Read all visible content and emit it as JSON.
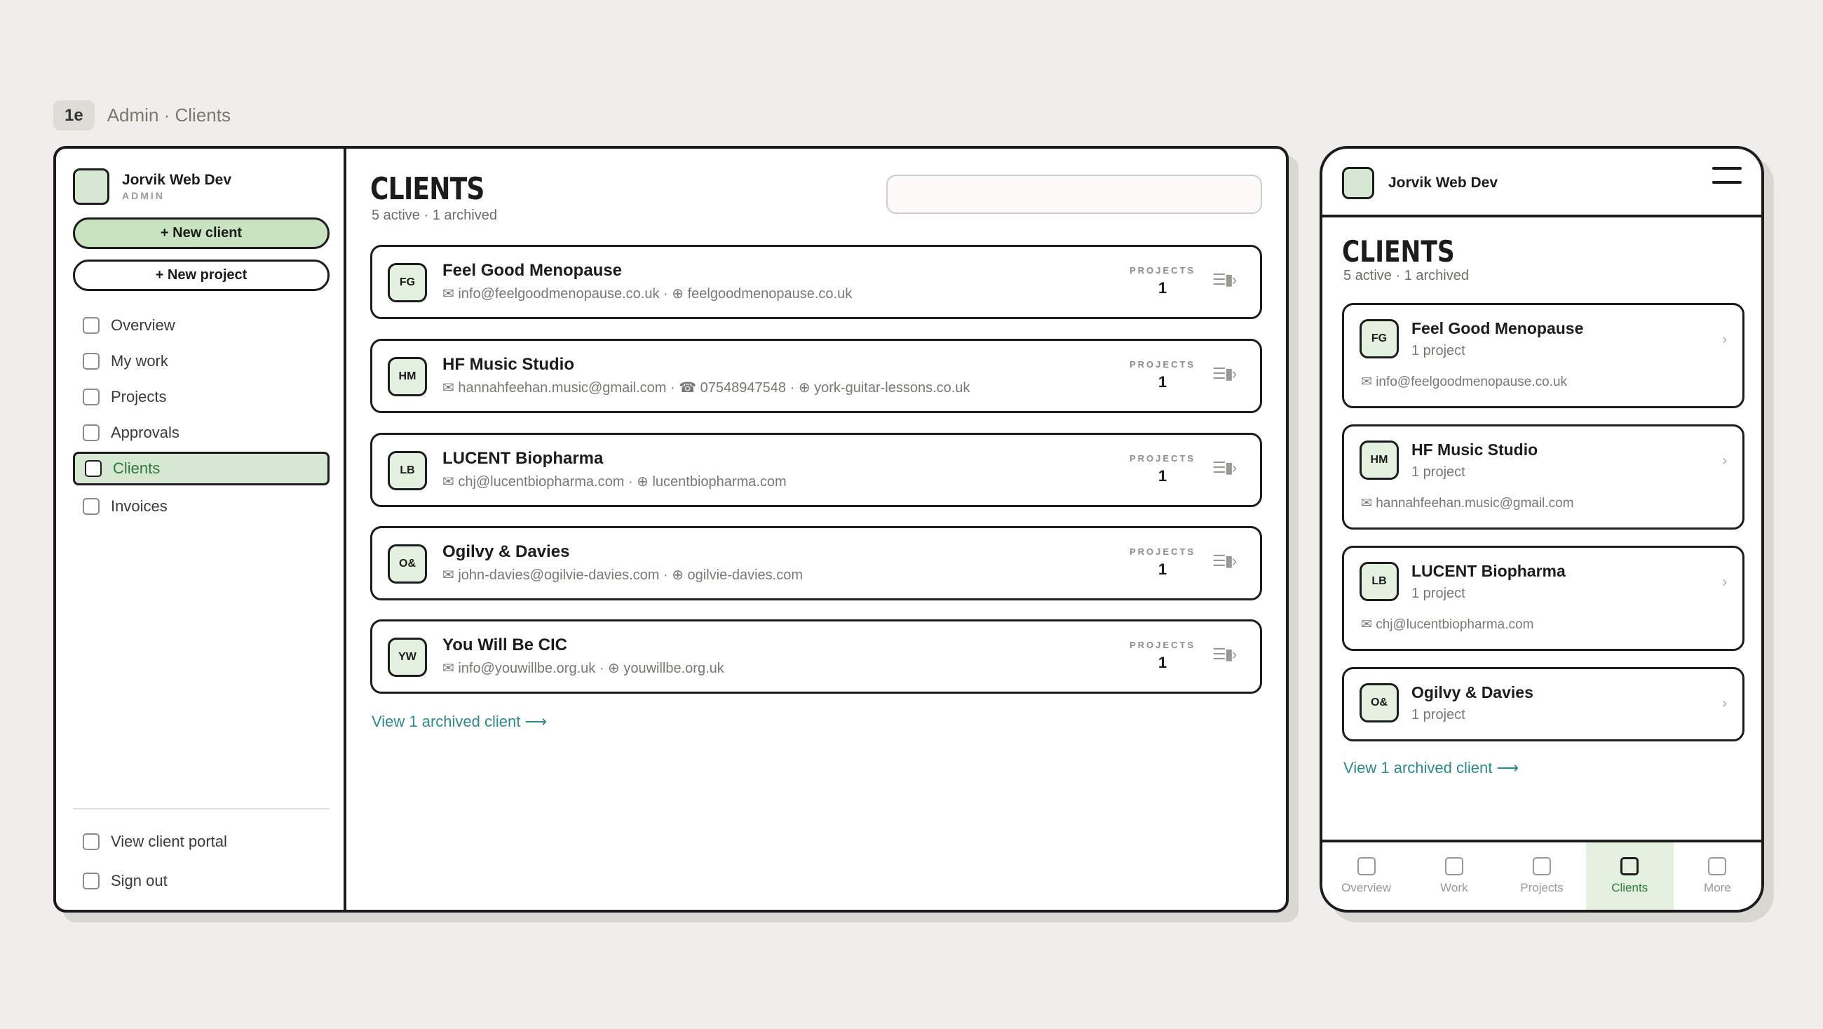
{
  "caption": {
    "tag": "1e",
    "crumb": "Admin · Clients"
  },
  "brand": {
    "name": "Jorvik Web Dev",
    "role": "ADMIN"
  },
  "sidebar": {
    "new_client": "+ New client",
    "new_project": "+ New project",
    "items": [
      {
        "label": "Overview"
      },
      {
        "label": "My work"
      },
      {
        "label": "Projects"
      },
      {
        "label": "Approvals"
      },
      {
        "label": "Clients"
      },
      {
        "label": "Invoices"
      }
    ],
    "footer": [
      {
        "label": "View client portal"
      },
      {
        "label": "Sign out"
      }
    ]
  },
  "main": {
    "title": "CLIENTS",
    "subtitle": "5 active · 1 archived",
    "search_placeholder": "",
    "projects_label": "PROJECTS",
    "clients": [
      {
        "initials": "FG",
        "name": "Feel Good Menopause",
        "info": "✉ info@feelgoodmenopause.co.uk · ⊕ feelgoodmenopause.co.uk",
        "projects": "1"
      },
      {
        "initials": "HM",
        "name": "HF Music Studio",
        "info": "✉ hannahfeehan.music@gmail.com · ☎ 07548947548 · ⊕ york-guitar-lessons.co.uk",
        "projects": "1"
      },
      {
        "initials": "LB",
        "name": "LUCENT Biopharma",
        "info": "✉ chj@lucentbiopharma.com · ⊕ lucentbiopharma.com",
        "projects": "1"
      },
      {
        "initials": "O&",
        "name": "Ogilvy & Davies",
        "info": "✉ john-davies@ogilvie-davies.com · ⊕ ogilvie-davies.com",
        "projects": "1"
      },
      {
        "initials": "YW",
        "name": "You Will Be CIC",
        "info": "✉ info@youwillbe.org.uk · ⊕ youwillbe.org.uk",
        "projects": "1"
      }
    ],
    "card_actions": "☰▮›",
    "archived_link": "View 1 archived client ⟶"
  },
  "mobile": {
    "title": "CLIENTS",
    "subtitle": "5 active · 1 archived",
    "clients": [
      {
        "initials": "FG",
        "name": "Feel Good Menopause",
        "projects": "1 project",
        "email": "✉ info@feelgoodmenopause.co.uk"
      },
      {
        "initials": "HM",
        "name": "HF Music Studio",
        "projects": "1 project",
        "email": "✉ hannahfeehan.music@gmail.com"
      },
      {
        "initials": "LB",
        "name": "LUCENT Biopharma",
        "projects": "1 project",
        "email": "✉ chj@lucentbiopharma.com"
      },
      {
        "initials": "O&",
        "name": "Ogilvy & Davies",
        "projects": "1 project"
      }
    ],
    "chevron": "›",
    "archived_link": "View 1 archived client ⟶",
    "tabs": [
      {
        "label": "Overview"
      },
      {
        "label": "Work"
      },
      {
        "label": "Projects"
      },
      {
        "label": "Clients"
      },
      {
        "label": "More"
      }
    ]
  },
  "colors": {
    "accent_green": "#c9e2c0",
    "link": "#2e8a8a",
    "background": "#efeeea"
  }
}
